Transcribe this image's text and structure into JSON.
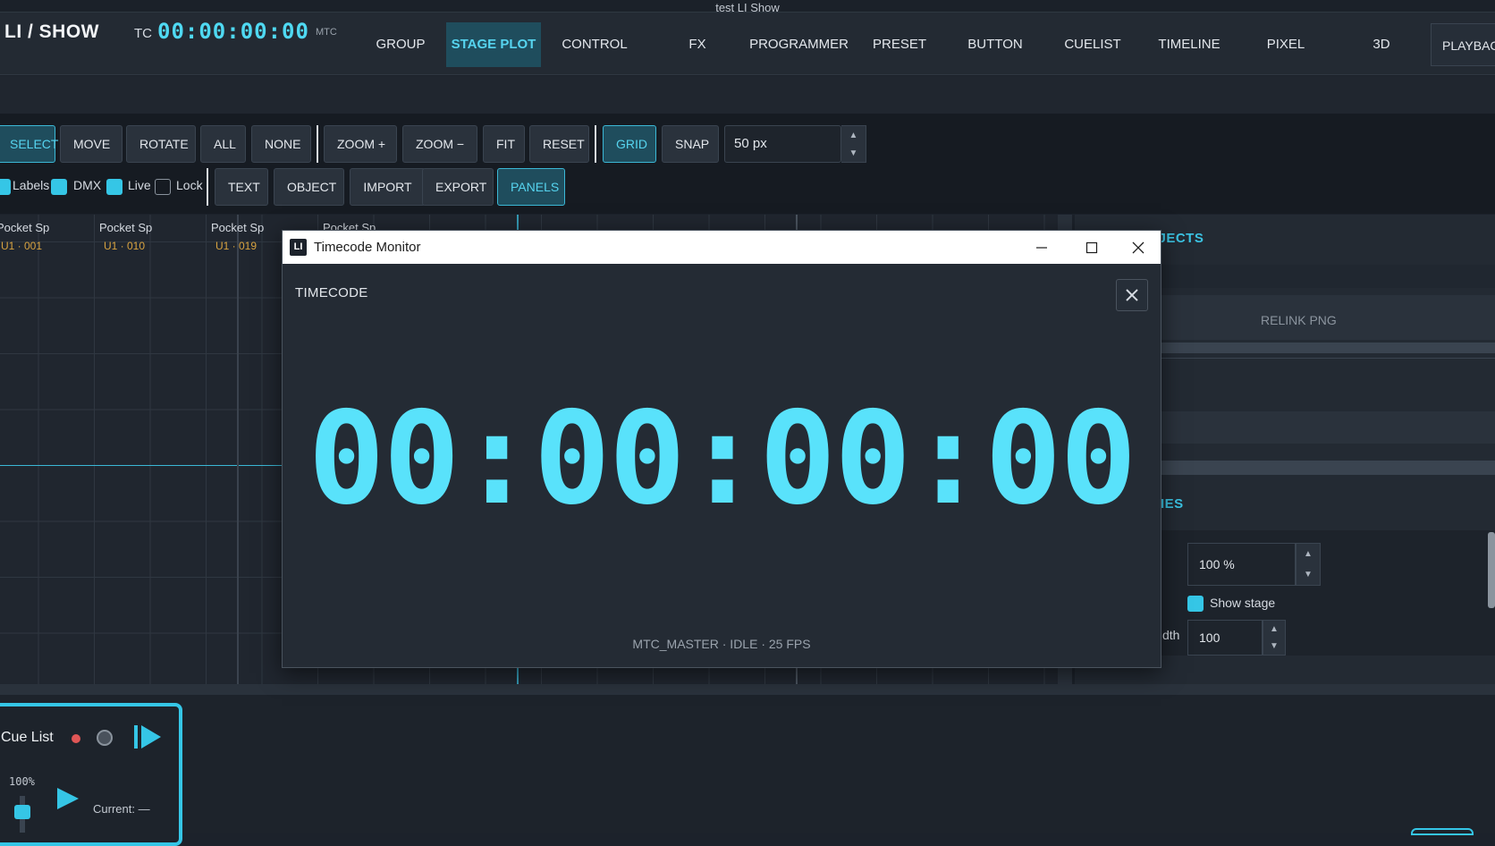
{
  "window_title": "test LI Show",
  "app": {
    "name": "LI / SHOW",
    "tc_label": "TC",
    "timecode": "00:00:00:00",
    "mtc_label": "MTC"
  },
  "nav": {
    "tabs": [
      "GROUP",
      "STAGE PLOT",
      "CONTROL",
      "FX",
      "PROGRAMMER",
      "PRESET",
      "BUTTON",
      "CUELIST",
      "TIMELINE",
      "PIXEL",
      "3D"
    ],
    "active": "STAGE PLOT",
    "playback": "PLAYBACK"
  },
  "toolbar": {
    "row1": [
      "SELECT",
      "MOVE",
      "ROTATE",
      "ALL",
      "NONE",
      "ZOOM +",
      "ZOOM −",
      "FIT",
      "RESET",
      "GRID",
      "SNAP"
    ],
    "grid_size": "50 px",
    "checks": [
      "Labels",
      "DMX",
      "Live",
      "Lock"
    ],
    "row2": [
      "TEXT",
      "OBJECT",
      "IMPORT",
      "EXPORT",
      "PANELS"
    ]
  },
  "fixtures": [
    {
      "name": "Pocket Sp",
      "addr": "U1 · 001"
    },
    {
      "name": "Pocket Sp",
      "addr": "U1 · 010"
    },
    {
      "name": "Pocket Sp",
      "addr": "U1 · 019"
    },
    {
      "name": "Pocket Sp",
      "addr": ""
    }
  ],
  "right_panel": {
    "objects_heading": "OBJECTS",
    "relink_label": "RELINK PNG",
    "properties_heading": "IES",
    "scale_value": "100 %",
    "show_stage_label": "Show stage",
    "width_label": "dth",
    "width_value": "100"
  },
  "cue": {
    "title": "Cue List",
    "level": "100%",
    "current": "Current: —"
  },
  "modal": {
    "title": "Timecode Monitor",
    "logo": "LI",
    "header": "TIMECODE",
    "timecode": "00:00:00:00",
    "status": "MTC_MASTER · IDLE · 25 FPS"
  },
  "colors": {
    "accent": "#35c6e6",
    "timecode": "#59e2fb",
    "address": "#d8a340",
    "record": "#e05656"
  }
}
